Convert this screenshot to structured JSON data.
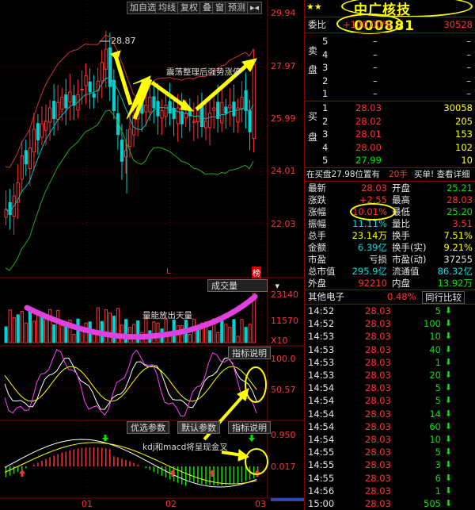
{
  "toolbar": {
    "add_watch": "加自选",
    "ma_lines": "均线",
    "adjust": "复权",
    "overlay": "叠",
    "window": "窗",
    "forecast": "预测",
    "menu": "▸◂"
  },
  "price_chart": {
    "y_labels": [
      "29.94",
      "27.97",
      "25.99",
      "24.01",
      "22.03"
    ],
    "high_marker": "28.87",
    "annotation": "震荡整理后强势涨停",
    "l_marker": "L",
    "badge": "榜"
  },
  "volume_panel": {
    "button": "成交量",
    "y_labels": [
      "23140",
      "11570",
      "X10"
    ],
    "annotation": "量能放出天量"
  },
  "kdj_panel": {
    "button": "指标说明",
    "y_labels": [
      "100.0",
      "50.57"
    ]
  },
  "macd_panel": {
    "buttons": [
      "优选参数",
      "默认参数",
      "指标说明"
    ],
    "y_labels": [
      "0.950",
      "0.017"
    ],
    "annotation": "kdj和macd将呈现金叉"
  },
  "x_axis": [
    "01",
    "02",
    "03"
  ],
  "quote": {
    "title": "中广核技 000881",
    "stars": "★★",
    "weibi_label": "委比",
    "weibi_value": "+100.00%",
    "weicha_value": "30528",
    "sell_label": "卖盘",
    "buy_label": "买盘",
    "sell": [
      {
        "level": "5",
        "price": "–",
        "vol": "–"
      },
      {
        "level": "4",
        "price": "–",
        "vol": "–"
      },
      {
        "level": "3",
        "price": "–",
        "vol": "–"
      },
      {
        "level": "2",
        "price": "–",
        "vol": "–"
      },
      {
        "level": "1",
        "price": "–",
        "vol": "–"
      }
    ],
    "buy": [
      {
        "level": "1",
        "price": "28.03",
        "vol": "30058"
      },
      {
        "level": "2",
        "price": "28.02",
        "vol": "205"
      },
      {
        "level": "3",
        "price": "28.01",
        "vol": "153"
      },
      {
        "level": "4",
        "price": "28.00",
        "vol": "102"
      },
      {
        "level": "5",
        "price": "27.99",
        "vol": "10"
      }
    ],
    "ticker_bar": {
      "text": "在买盘27.98位置有",
      "lots": "20手",
      "action": "买单! 查看详细"
    },
    "stats": [
      {
        "l1": "最新",
        "v1": "28.03",
        "c1": "red",
        "l2": "开盘",
        "v2": "25.21",
        "c2": "green"
      },
      {
        "l1": "涨跌",
        "v1": "+2.55",
        "c1": "red",
        "l2": "最高",
        "v2": "28.03",
        "c2": "red"
      },
      {
        "l1": "涨幅",
        "v1": "10.01%",
        "c1": "red",
        "l2": "最低",
        "v2": "25.20",
        "c2": "green"
      },
      {
        "l1": "振幅",
        "v1": "11.11%",
        "c1": "cyan",
        "l2": "量比",
        "v2": "3.51",
        "c2": "red"
      },
      {
        "l1": "总手",
        "v1": "23.14万",
        "c1": "yellow",
        "l2": "换手",
        "v2": "7.51%",
        "c2": "yellow"
      },
      {
        "l1": "金额",
        "v1": "6.39亿",
        "c1": "cyan",
        "l2": "换手(实)",
        "v2": "9.21%",
        "c2": "yellow"
      },
      {
        "l1": "市盈",
        "v1": "亏损",
        "c1": "white",
        "l2": "市盈(动)",
        "v2": "37255",
        "c2": "white"
      },
      {
        "l1": "总市值",
        "v1": "295.9亿",
        "c1": "cyan",
        "l2": "流通值",
        "v2": "86.32亿",
        "c2": "cyan"
      },
      {
        "l1": "外盘",
        "v1": "92210",
        "c1": "red",
        "l2": "内盘",
        "v2": "13.92万",
        "c2": "green"
      }
    ],
    "sector_name": "其他电子",
    "sector_change": "0.48%",
    "compare_button": "同行比较",
    "trades": [
      {
        "time": "14:52",
        "price": "28.03",
        "vol": "5",
        "dir": "down"
      },
      {
        "time": "14:52",
        "price": "28.03",
        "vol": "100",
        "dir": "down"
      },
      {
        "time": "14:53",
        "price": "28.03",
        "vol": "10",
        "dir": "down"
      },
      {
        "time": "14:53",
        "price": "28.03",
        "vol": "40",
        "dir": "down"
      },
      {
        "time": "14:53",
        "price": "28.03",
        "vol": "1",
        "dir": "down"
      },
      {
        "time": "14:53",
        "price": "28.03",
        "vol": "20",
        "dir": "down"
      },
      {
        "time": "14:54",
        "price": "28.03",
        "vol": "5",
        "dir": "down"
      },
      {
        "time": "14:54",
        "price": "28.03",
        "vol": "5",
        "dir": "down"
      },
      {
        "time": "14:54",
        "price": "28.03",
        "vol": "14",
        "dir": "down"
      },
      {
        "time": "14:54",
        "price": "28.03",
        "vol": "60",
        "dir": "down"
      },
      {
        "time": "14:54",
        "price": "28.03",
        "vol": "10",
        "dir": "down"
      },
      {
        "time": "14:55",
        "price": "28.03",
        "vol": "5",
        "dir": "down"
      },
      {
        "time": "14:55",
        "price": "28.03",
        "vol": "3",
        "dir": "down"
      },
      {
        "time": "14:55",
        "price": "28.03",
        "vol": "6",
        "dir": "down"
      },
      {
        "time": "14:56",
        "price": "28.03",
        "vol": "1",
        "dir": "down"
      },
      {
        "time": "15:00",
        "price": "28.03",
        "vol": "505",
        "dir": "down"
      }
    ]
  },
  "colors": {
    "up": "#ff3232",
    "down": "#00e600",
    "boll_upper": "#cc3333",
    "boll_mid": "#00c0c0",
    "boll_lower": "#22aa22",
    "highlight": "#ffff00",
    "volume_curve": "#e040e0"
  }
}
